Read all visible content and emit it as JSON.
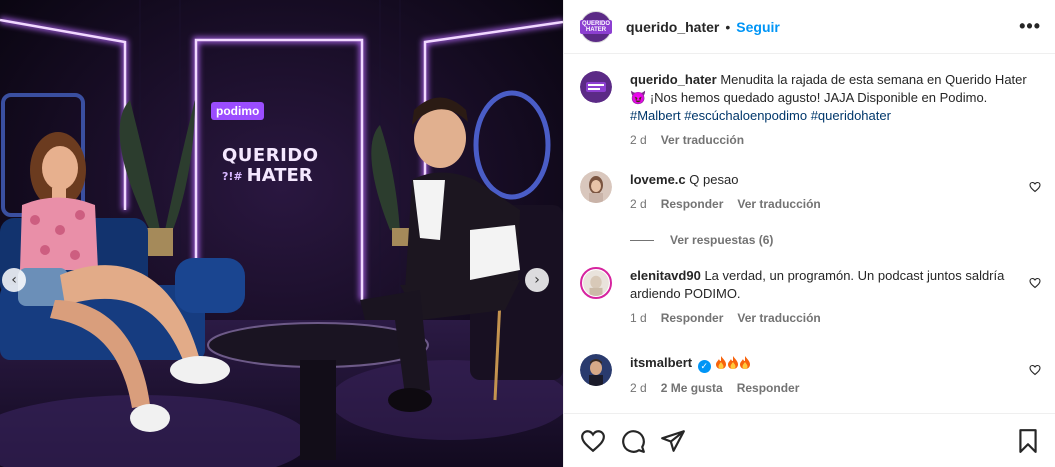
{
  "post": {
    "username": "querido_hater",
    "follow_label": "Seguir",
    "avatar_text": "QUERIDO HATER",
    "more_label": "•••",
    "dot": "•"
  },
  "media": {
    "logo_podimo": "podimo",
    "logo_line1": "QUERIDO",
    "logo_line2": "?!#",
    "logo_line3": "HATER",
    "prev_arrow": "‹",
    "next_arrow": "›"
  },
  "caption": {
    "username": "querido_hater",
    "text_1": "Menudita la rajada de esta semana en Querido Hater",
    "emoji": "😈",
    "text_2": "¡Nos hemos quedado agusto! JAJA Disponible en Podimo.",
    "tags": [
      "#Malbert",
      "#escúchaloenpodimo",
      "#queridohater"
    ],
    "time": "2 d",
    "translate": "Ver traducción"
  },
  "comments": [
    {
      "username": "loveme.c",
      "text": "Q pesao",
      "time": "2 d",
      "reply": "Responder",
      "translate": "Ver traducción",
      "view_replies": "Ver respuestas (6)"
    },
    {
      "username": "elenitavd90",
      "text": "La verdad, un programón. Un podcast juntos saldría ardiendo PODIMO.",
      "time": "1 d",
      "reply": "Responder",
      "translate": "Ver traducción"
    },
    {
      "username": "itsmalbert",
      "verified_mark": "✓",
      "time": "2 d",
      "likes": "2 Me gusta",
      "reply": "Responder"
    }
  ],
  "colors": {
    "link_blue": "#0095f6",
    "hashtag": "#00376b",
    "meta_gray": "#737373",
    "neon_purple": "#c77dff"
  },
  "icons": [
    "heart-icon",
    "comment-icon",
    "share-icon",
    "bookmark-icon",
    "verified-icon",
    "fire-emoji-icon",
    "devil-emoji-icon",
    "more-options-icon"
  ]
}
